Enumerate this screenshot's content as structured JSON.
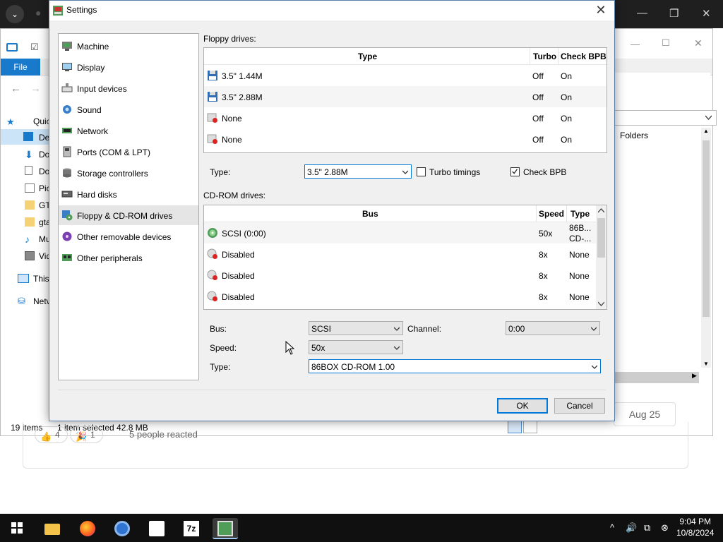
{
  "background_window": {
    "file_tab": "File",
    "sidebar_items": [
      "Quic",
      "De",
      "Do",
      "Do",
      "Pic",
      "GT",
      "gta",
      "Mu",
      "Vid",
      "This",
      "Netv"
    ],
    "status_items": "19 items",
    "status_selected": "1 item selected  42.8 MB",
    "right_pane_header": "Folders"
  },
  "web_page": {
    "reaction_like_count": "4",
    "reaction_second_count": "1",
    "reacted_text": "5 people reacted",
    "date_button": "Aug 25"
  },
  "taskbar": {
    "time": "9:04 PM",
    "date": "10/8/2024",
    "apps": [
      "file-explorer",
      "firefox",
      "chrome",
      "itch",
      "7zip",
      "86box"
    ]
  },
  "dialog": {
    "title": "Settings",
    "categories": [
      {
        "label": "Machine",
        "icon": "machine-icon"
      },
      {
        "label": "Display",
        "icon": "display-icon"
      },
      {
        "label": "Input devices",
        "icon": "keyboard-icon"
      },
      {
        "label": "Sound",
        "icon": "sound-icon"
      },
      {
        "label": "Network",
        "icon": "network-icon"
      },
      {
        "label": "Ports (COM & LPT)",
        "icon": "ports-icon"
      },
      {
        "label": "Storage controllers",
        "icon": "storage-icon"
      },
      {
        "label": "Hard disks",
        "icon": "hard-disk-icon"
      },
      {
        "label": "Floppy & CD-ROM drives",
        "icon": "floppy-cdrom-icon"
      },
      {
        "label": "Other removable devices",
        "icon": "removable-icon"
      },
      {
        "label": "Other peripherals",
        "icon": "peripherals-icon"
      }
    ],
    "selected_category": "Floppy & CD-ROM drives",
    "floppy": {
      "section_label": "Floppy drives:",
      "columns": [
        "Type",
        "Turbo",
        "Check BPB"
      ],
      "rows": [
        {
          "type": "3.5\" 1.44M",
          "turbo": "Off",
          "check_bpb": "On"
        },
        {
          "type": "3.5\" 2.88M",
          "turbo": "Off",
          "check_bpb": "On"
        },
        {
          "type": "None",
          "turbo": "Off",
          "check_bpb": "On"
        },
        {
          "type": "None",
          "turbo": "Off",
          "check_bpb": "On"
        }
      ],
      "type_label": "Type:",
      "type_value": "3.5\" 2.88M",
      "turbo_label": "Turbo timings",
      "turbo_checked": false,
      "check_bpb_label": "Check BPB",
      "check_bpb_checked": true
    },
    "cdrom": {
      "section_label": "CD-ROM drives:",
      "columns": [
        "Bus",
        "Speed",
        "Type"
      ],
      "rows": [
        {
          "bus": "SCSI (0:00)",
          "speed": "50x",
          "type_line1": "86B...",
          "type_line2": "CD-..."
        },
        {
          "bus": "Disabled",
          "speed": "8x",
          "type_line1": "None",
          "type_line2": ""
        },
        {
          "bus": "Disabled",
          "speed": "8x",
          "type_line1": "None",
          "type_line2": ""
        },
        {
          "bus": "Disabled",
          "speed": "8x",
          "type_line1": "None",
          "type_line2": ""
        }
      ],
      "bus_label": "Bus:",
      "bus_value": "SCSI",
      "channel_label": "Channel:",
      "channel_value": "0:00",
      "speed_label": "Speed:",
      "speed_value": "50x",
      "type_label": "Type:",
      "type_value": "86BOX CD-ROM 1.00"
    },
    "ok_label": "OK",
    "cancel_label": "Cancel"
  },
  "colors": {
    "accent": "#0078d7",
    "taskbar": "#101010",
    "selected_row": "#e5e5e5"
  }
}
